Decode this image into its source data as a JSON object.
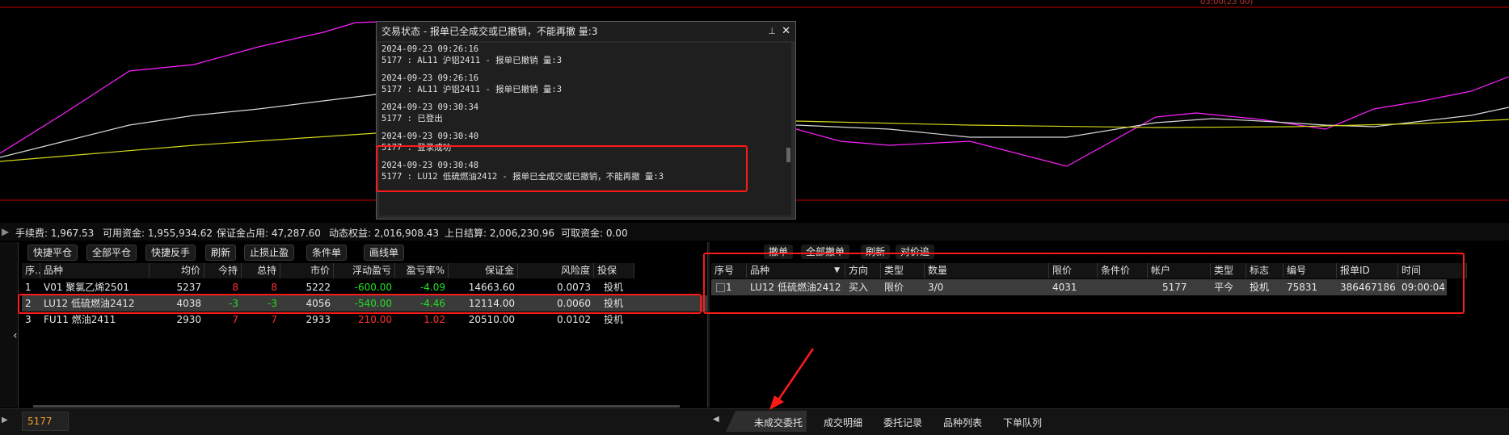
{
  "chart": {
    "colors": {
      "magenta": "#ff20ff",
      "white": "#d8d8d8",
      "yellow": "#d6d61a",
      "grid_red": "#c00000"
    }
  },
  "account": {
    "fee": "手续费: 1,967.53",
    "available": "可用资金: 1,955,934.62",
    "margin_used": "保证金占用: 47,287.60",
    "equity": "动态权益: 2,016,908.43",
    "settle": "上日结算: 2,006,230.96",
    "withdrawable": "可取资金: 0.00"
  },
  "position_toolbar": [
    "快捷平仓",
    "全部平仓",
    "快捷反手",
    "刷新",
    "止损止盈",
    "条件单",
    "画线单"
  ],
  "order_toolbar": [
    "撤单",
    "全部撤单",
    "刷新",
    "对价追"
  ],
  "positions": {
    "headers": [
      "序..",
      "品种",
      "均价",
      "今持",
      "总持",
      "市价",
      "浮动盈亏",
      "盈亏率%",
      "保证金",
      "风险度",
      "投保"
    ],
    "rows": [
      {
        "idx": "1",
        "name": "V01 聚氯乙烯2501",
        "avg": "5237",
        "today": "8",
        "total": "8",
        "mkt": "5222",
        "pnl": "-600.00",
        "rate": "-4.09",
        "margin": "14663.60",
        "risk": "0.0073",
        "hedge": "投机",
        "dir": "short_loss"
      },
      {
        "idx": "2",
        "name": "LU12 低硫燃油2412",
        "avg": "4038",
        "today": "-3",
        "total": "-3",
        "mkt": "4056",
        "pnl": "-540.00",
        "rate": "-4.46",
        "margin": "12114.00",
        "risk": "0.0060",
        "hedge": "投机",
        "dir": "loss"
      },
      {
        "idx": "3",
        "name": "FU11 燃油2411",
        "avg": "2930",
        "today": "7",
        "total": "7",
        "mkt": "2933",
        "pnl": "210.00",
        "rate": "1.02",
        "margin": "20510.00",
        "risk": "0.0102",
        "hedge": "投机",
        "dir": "gain"
      }
    ]
  },
  "orders": {
    "headers": [
      "序号",
      "品种",
      "方向",
      "类型",
      "数量",
      "限价",
      "条件价",
      "帐户",
      "类型",
      "标志",
      "编号",
      "报单ID",
      "时间"
    ],
    "rows": [
      {
        "idx": "1",
        "name": "LU12 低硫燃油2412",
        "dir": "买入",
        "type": "限价",
        "qty": "3/0",
        "price": "4031",
        "cond": "",
        "account": "5177",
        "type2": "平今",
        "flag": "投机",
        "no": "75831",
        "id": "386467186",
        "time": "09:00:04"
      }
    ]
  },
  "bottom": {
    "account_value": "5177",
    "tabs": [
      "未成交委托",
      "成交明细",
      "委托记录",
      "品种列表",
      "下单队列"
    ]
  },
  "popup": {
    "title": "交易状态 - 报单已全成交或已撤销，不能再撤 量:3",
    "lines": [
      "2024-09-23 09:26:16",
      "5177 : AL11 沪铝2411 - 报单已撤销 量:3",
      "",
      "2024-09-23 09:26:16",
      "5177 : AL11 沪铝2411 - 报单已撤销 量:3",
      "",
      "2024-09-23 09:30:34",
      "5177 : 已登出",
      "",
      "2024-09-23 09:30:40",
      "5177 : 登录成功",
      "",
      "2024-09-23 09:30:48",
      "5177 : LU12 低硫燃油2412 - 报单已全成交或已撤销，不能再撤 量:3"
    ],
    "pin_icon": "pin-icon",
    "close_icon": "close-icon"
  }
}
